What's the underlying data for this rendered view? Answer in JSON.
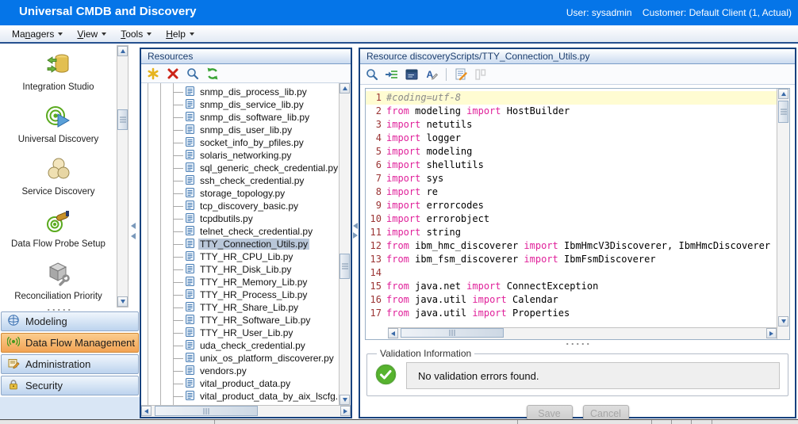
{
  "colors": {
    "banner_bg": "#0575e8",
    "selected_accordion": "#f2a354",
    "keyword": "#e0219a",
    "comment": "#8a8a8a",
    "line_number": "#9a3333",
    "panel_border": "#17427e",
    "current_line_bg": "#fffcd2",
    "tree_selection_bg": "#b9c7d9"
  },
  "header": {
    "title": "Universal CMDB and Discovery",
    "user_label": "User: sysadmin",
    "customer_label": "Customer: Default Client (1, Actual)"
  },
  "menu": {
    "items": [
      {
        "pre": "Ma",
        "key": "n",
        "post": "agers"
      },
      {
        "pre": "",
        "key": "V",
        "post": "iew"
      },
      {
        "pre": "",
        "key": "T",
        "post": "ools"
      },
      {
        "pre": "",
        "key": "H",
        "post": "elp"
      }
    ]
  },
  "sidebar": {
    "modules": [
      {
        "label": "Integration Studio",
        "icon": "integration-studio-icon"
      },
      {
        "label": "Universal Discovery",
        "icon": "universal-discovery-icon"
      },
      {
        "label": "Service Discovery",
        "icon": "service-discovery-icon"
      },
      {
        "label": "Data Flow Probe Setup",
        "icon": "data-flow-probe-setup-icon"
      },
      {
        "label": "Reconciliation Priority",
        "icon": "reconciliation-priority-icon"
      }
    ],
    "accordion": [
      {
        "label": "Modeling",
        "icon": "modeling-cube-icon",
        "active": false
      },
      {
        "label": "Data Flow Management",
        "icon": "data-flow-icon",
        "active": true
      },
      {
        "label": "Administration",
        "icon": "administration-icon",
        "active": false
      },
      {
        "label": "Security",
        "icon": "security-lock-icon",
        "active": false
      }
    ]
  },
  "resources": {
    "title": "Resources",
    "toolbar_icons": [
      "new-resource-icon",
      "delete-resource-icon",
      "search-icon",
      "refresh-icon"
    ],
    "selected_file": "TTY_Connection_Utils.py",
    "files": [
      "snmp_dis_process_lib.py",
      "snmp_dis_service_lib.py",
      "snmp_dis_software_lib.py",
      "snmp_dis_user_lib.py",
      "socket_info_by_pfiles.py",
      "solaris_networking.py",
      "sql_generic_check_credential.py",
      "ssh_check_credential.py",
      "storage_topology.py",
      "tcp_discovery_basic.py",
      "tcpdbutils.py",
      "telnet_check_credential.py",
      "TTY_Connection_Utils.py",
      "TTY_HR_CPU_Lib.py",
      "TTY_HR_Disk_Lib.py",
      "TTY_HR_Memory_Lib.py",
      "TTY_HR_Process_Lib.py",
      "TTY_HR_Share_Lib.py",
      "TTY_HR_Software_Lib.py",
      "TTY_HR_User_Lib.py",
      "uda_check_credential.py",
      "unix_os_platform_discoverer.py",
      "vendors.py",
      "vital_product_data.py",
      "vital_product_data_by_aix_lscfg.py"
    ]
  },
  "editor": {
    "title": "Resource discoveryScripts/TTY_Connection_Utils.py",
    "toolbar_icons": [
      "find-icon",
      "goto-line-icon",
      "console-window-icon",
      "edit-as-text-icon",
      "external-editor-icon",
      "structure-icon"
    ],
    "lines": [
      {
        "n": "1",
        "hl": true,
        "tokens": [
          [
            "cmt",
            "#coding=utf-8"
          ]
        ]
      },
      {
        "n": "2",
        "tokens": [
          [
            "kw",
            "from"
          ],
          [
            "tx",
            " modeling "
          ],
          [
            "kw",
            "import"
          ],
          [
            "tx",
            " HostBuilder"
          ]
        ]
      },
      {
        "n": "3",
        "tokens": [
          [
            "kw",
            "import"
          ],
          [
            "tx",
            " netutils"
          ]
        ]
      },
      {
        "n": "4",
        "tokens": [
          [
            "kw",
            "import"
          ],
          [
            "tx",
            " logger"
          ]
        ]
      },
      {
        "n": "5",
        "tokens": [
          [
            "kw",
            "import"
          ],
          [
            "tx",
            " modeling"
          ]
        ]
      },
      {
        "n": "6",
        "tokens": [
          [
            "kw",
            "import"
          ],
          [
            "tx",
            " shellutils"
          ]
        ]
      },
      {
        "n": "7",
        "tokens": [
          [
            "kw",
            "import"
          ],
          [
            "tx",
            " sys"
          ]
        ]
      },
      {
        "n": "8",
        "tokens": [
          [
            "kw",
            "import"
          ],
          [
            "tx",
            " re"
          ]
        ]
      },
      {
        "n": "9",
        "tokens": [
          [
            "kw",
            "import"
          ],
          [
            "tx",
            " errorcodes"
          ]
        ]
      },
      {
        "n": "10",
        "tokens": [
          [
            "kw",
            "import"
          ],
          [
            "tx",
            " errorobject"
          ]
        ]
      },
      {
        "n": "11",
        "tokens": [
          [
            "kw",
            "import"
          ],
          [
            "tx",
            " string"
          ]
        ]
      },
      {
        "n": "12",
        "tokens": [
          [
            "kw",
            "from"
          ],
          [
            "tx",
            " ibm_hmc_discoverer "
          ],
          [
            "kw",
            "import"
          ],
          [
            "tx",
            " IbmHmcV3Discoverer, IbmHmcDiscoverer"
          ]
        ]
      },
      {
        "n": "13",
        "tokens": [
          [
            "kw",
            "from"
          ],
          [
            "tx",
            " ibm_fsm_discoverer "
          ],
          [
            "kw",
            "import"
          ],
          [
            "tx",
            " IbmFsmDiscoverer"
          ]
        ]
      },
      {
        "n": "14",
        "tokens": []
      },
      {
        "n": "15",
        "tokens": [
          [
            "kw",
            "from"
          ],
          [
            "tx",
            " java.net "
          ],
          [
            "kw",
            "import"
          ],
          [
            "tx",
            " ConnectException"
          ]
        ]
      },
      {
        "n": "16",
        "tokens": [
          [
            "kw",
            "from"
          ],
          [
            "tx",
            " java.util "
          ],
          [
            "kw",
            "import"
          ],
          [
            "tx",
            " Calendar"
          ]
        ]
      },
      {
        "n": "17",
        "tokens": [
          [
            "kw",
            "from"
          ],
          [
            "tx",
            " java.util "
          ],
          [
            "kw",
            "import"
          ],
          [
            "tx",
            " Properties"
          ]
        ]
      }
    ]
  },
  "validation": {
    "legend": "Validation Information",
    "message": "No validation errors found.",
    "status_icon": "success-check-icon"
  },
  "actions": {
    "save": "Save",
    "cancel": "Cancel"
  }
}
